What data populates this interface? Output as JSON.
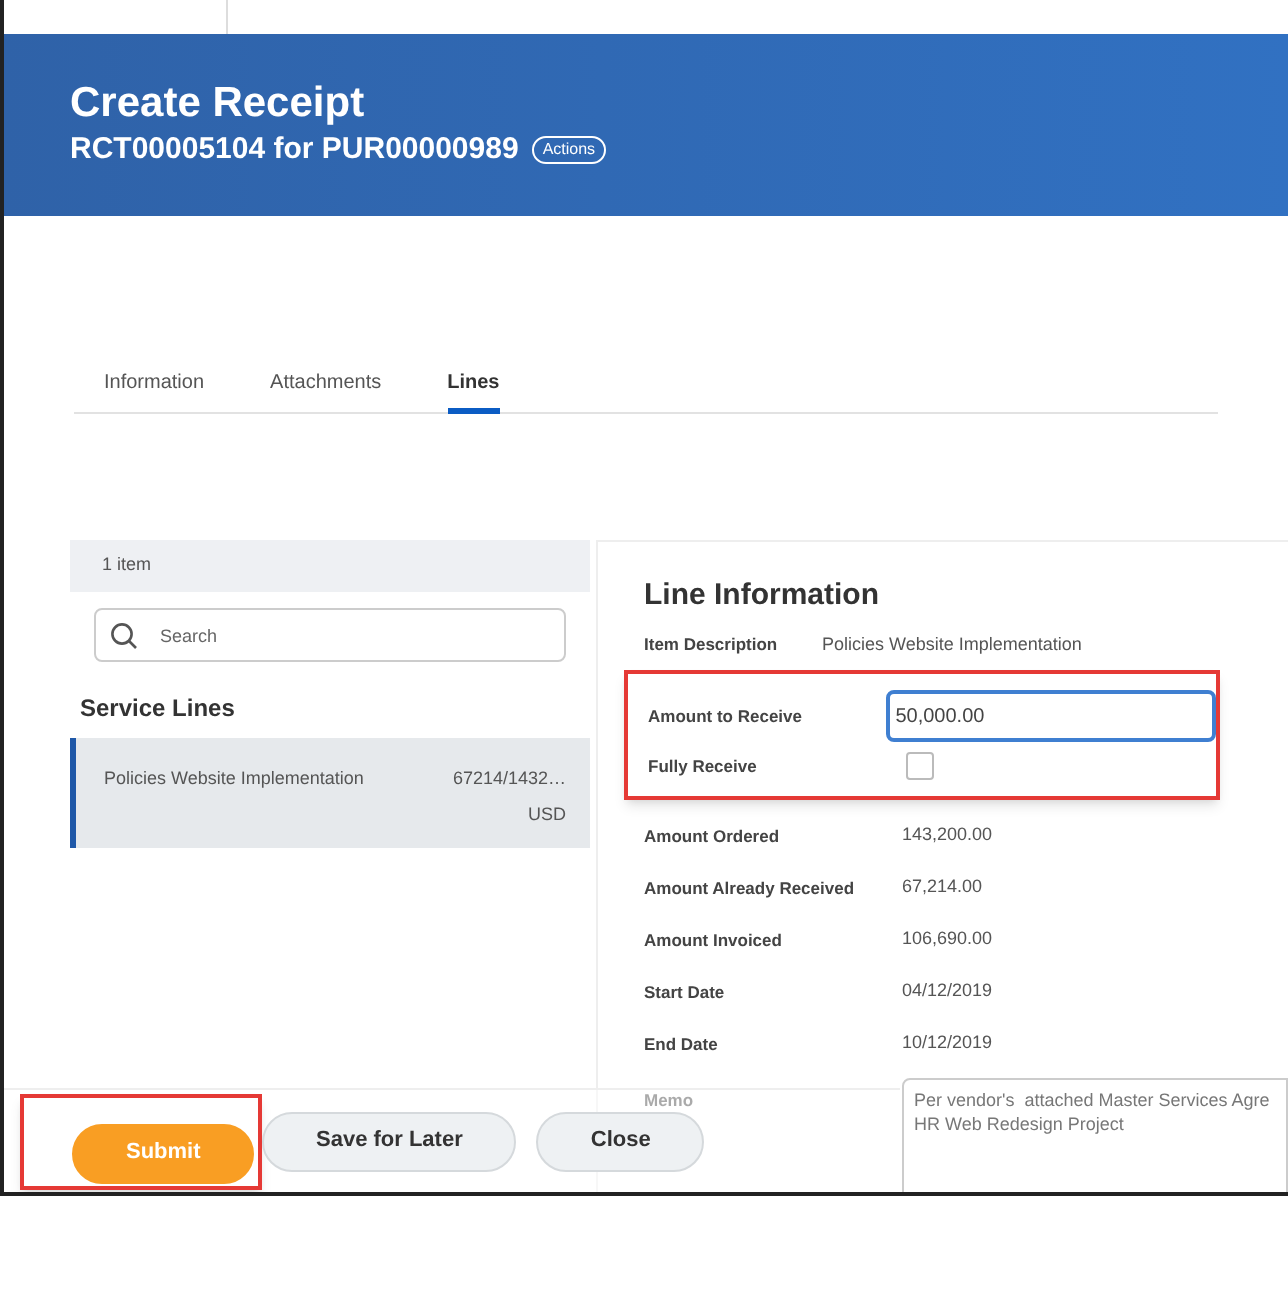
{
  "header": {
    "title": "Create Receipt",
    "subtitle": "RCT00005104 for PUR00000989",
    "actions_label": "Actions"
  },
  "tabs": [
    {
      "label": "Information",
      "selected": false
    },
    {
      "label": "Attachments",
      "selected": false
    },
    {
      "label": "Lines",
      "selected": true
    }
  ],
  "list_panel": {
    "count": "1 item",
    "search": {
      "placeholder": "Search"
    },
    "section_title": "Service Lines",
    "items": [
      {
        "name": "Policies Website Implementation",
        "amount": "67214/1432…",
        "currency": "USD",
        "selected": true
      }
    ]
  },
  "line_information": {
    "title": "Line Information",
    "item_description": {
      "label": "Item Description",
      "value": "Policies Website Implementation"
    },
    "highlighted": true,
    "amount_to_receive": {
      "label": "Amount to Receive",
      "value": "50,000.00"
    },
    "fully_receive": {
      "label": "Fully Receive",
      "checked": false
    },
    "details": [
      {
        "label": "Amount Ordered",
        "value": "143,200.00"
      },
      {
        "label": "Amount Already Received",
        "value": "67,214.00"
      },
      {
        "label": "Amount Invoiced",
        "value": "106,690.00"
      },
      {
        "label": "Start Date",
        "value": "04/12/2019"
      },
      {
        "label": "End Date",
        "value": "10/12/2019"
      }
    ],
    "memo": {
      "label": "Memo",
      "value": "Per vendor's  attached Master Services Agre\nHR Web Redesign Project"
    }
  },
  "footer": {
    "buttons": [
      {
        "label": "Submit",
        "kind": "primary",
        "highlighted": true
      },
      {
        "label": "Save for Later",
        "kind": "secondary",
        "highlighted": false
      },
      {
        "label": "Close",
        "kind": "secondary",
        "highlighted": false
      }
    ]
  }
}
